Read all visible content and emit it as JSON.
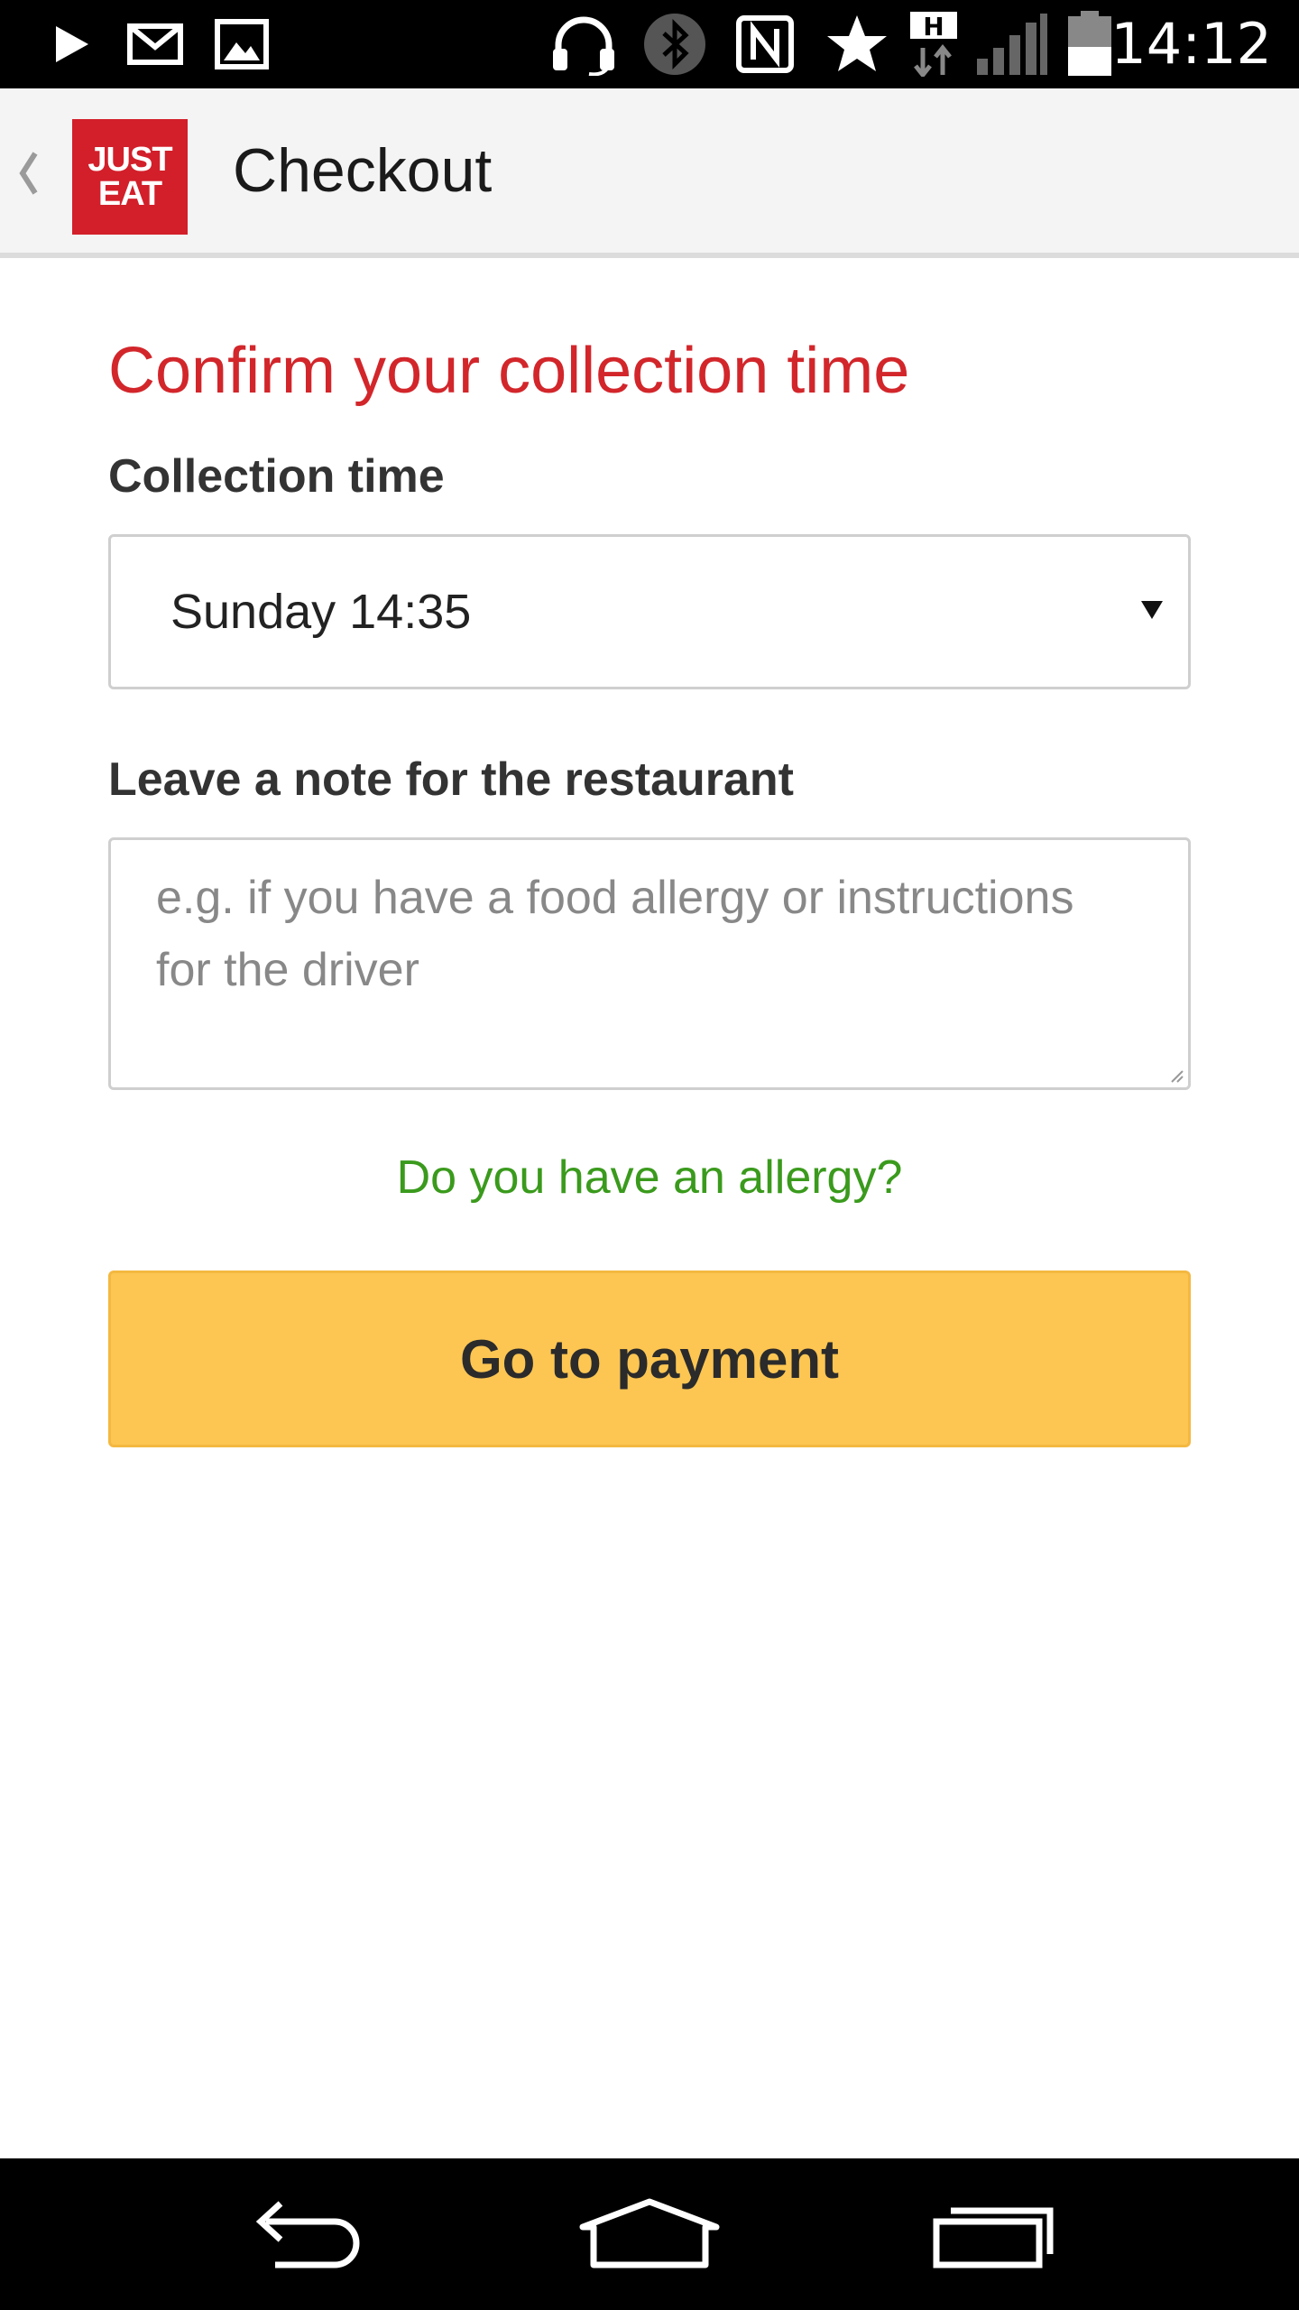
{
  "status_bar": {
    "time": "14:12",
    "icons": [
      "play-store-icon",
      "gmail-icon",
      "gallery-icon",
      "headset-icon",
      "bluetooth-icon",
      "nfc-icon",
      "star-icon",
      "hspa-data-icon",
      "signal-icon",
      "battery-icon"
    ]
  },
  "app_bar": {
    "logo_line1": "JUST",
    "logo_line2": "EAT",
    "title": "Checkout"
  },
  "form": {
    "heading": "Confirm your collection time",
    "collection_label": "Collection time",
    "collection_value": "Sunday 14:35",
    "note_label": "Leave a note for the restaurant",
    "note_placeholder": "e.g. if you have a food allergy or instructions for the driver",
    "allergy_link": "Do you have an allergy?",
    "pay_button": "Go to payment"
  },
  "nav_bar": {
    "icons": [
      "back-icon",
      "home-icon",
      "recents-icon"
    ]
  },
  "colors": {
    "heading_red": "#d2262b",
    "link_green": "#3a9a1c",
    "button_yellow": "#fdc652",
    "brand_red": "#d21f2a"
  }
}
